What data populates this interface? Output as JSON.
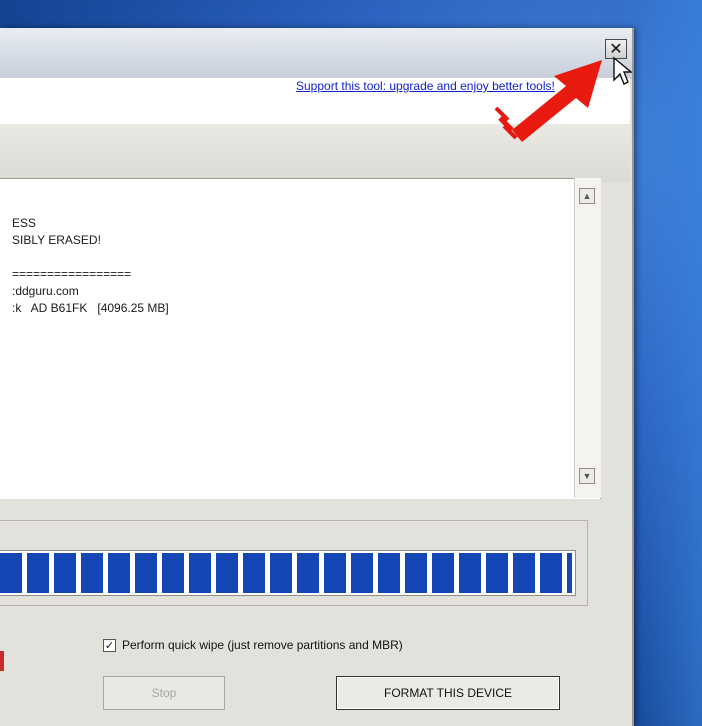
{
  "window": {
    "close_glyph": "✕",
    "support_link": "Support this tool: upgrade and enjoy better tools!"
  },
  "log": {
    "lines": [
      "ESS",
      "SIBLY ERASED!",
      "",
      "=================",
      ":ddguru.com",
      ":k   AD B61FK   [4096.25 MB]"
    ]
  },
  "progress": {
    "percent": 100
  },
  "options": {
    "quick_wipe_checked": true,
    "quick_wipe_label": "Perform quick wipe (just remove partitions and MBR)"
  },
  "buttons": {
    "stop": "Stop",
    "format": "FORMAT THIS DEVICE"
  },
  "colors": {
    "progress": "#1447b5",
    "arrow": "#e8190f",
    "link": "#1122cc"
  },
  "icons": {
    "close": "close-icon",
    "pointer": "mouse-pointer-icon",
    "arrow": "red-arrow-icon",
    "scroll_up": "scroll-up-icon",
    "scroll_down": "scroll-down-icon"
  }
}
